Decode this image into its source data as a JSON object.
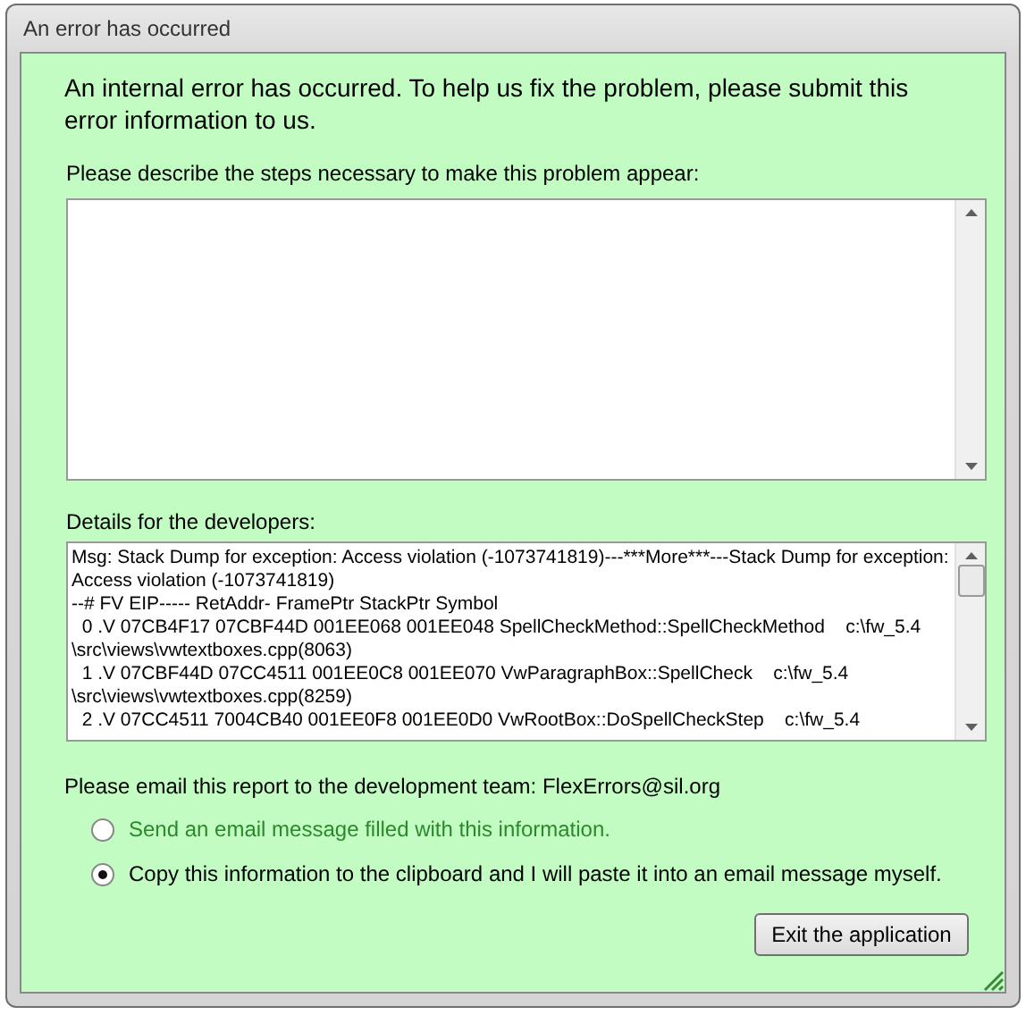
{
  "window": {
    "title": "An error has occurred"
  },
  "message": "An internal error has occurred. To help us fix the problem, please submit this error information to us.",
  "steps": {
    "label": "Please describe the steps necessary to make this problem appear:"
  },
  "details": {
    "label": "Details for the developers:",
    "lines": [
      "Msg: Stack Dump for exception: Access violation (-1073741819)---***More***---Stack Dump for exception:",
      "Access violation (-1073741819)",
      "--# FV EIP----- RetAddr- FramePtr StackPtr Symbol",
      "  0 .V 07CB4F17 07CBF44D 001EE068 001EE048 SpellCheckMethod::SpellCheckMethod    c:\\fw_5.4",
      "\\src\\views\\vwtextboxes.cpp(8063)",
      "  1 .V 07CBF44D 07CC4511 001EE0C8 001EE070 VwParagraphBox::SpellCheck    c:\\fw_5.4",
      "\\src\\views\\vwtextboxes.cpp(8259)",
      "  2 .V 07CC4511 7004CB40 001EE0F8 001EE0D0 VwRootBox::DoSpellCheckStep    c:\\fw_5.4"
    ]
  },
  "email_note": "Please email this report to the development team: FlexErrors@sil.org",
  "options": [
    {
      "label": "Send an email message filled with this information.",
      "selected": false,
      "disabled": true
    },
    {
      "label": "Copy this information to the clipboard and I will paste it into an email message myself.",
      "selected": true,
      "disabled": false
    }
  ],
  "buttons": [
    "Exit the application"
  ]
}
